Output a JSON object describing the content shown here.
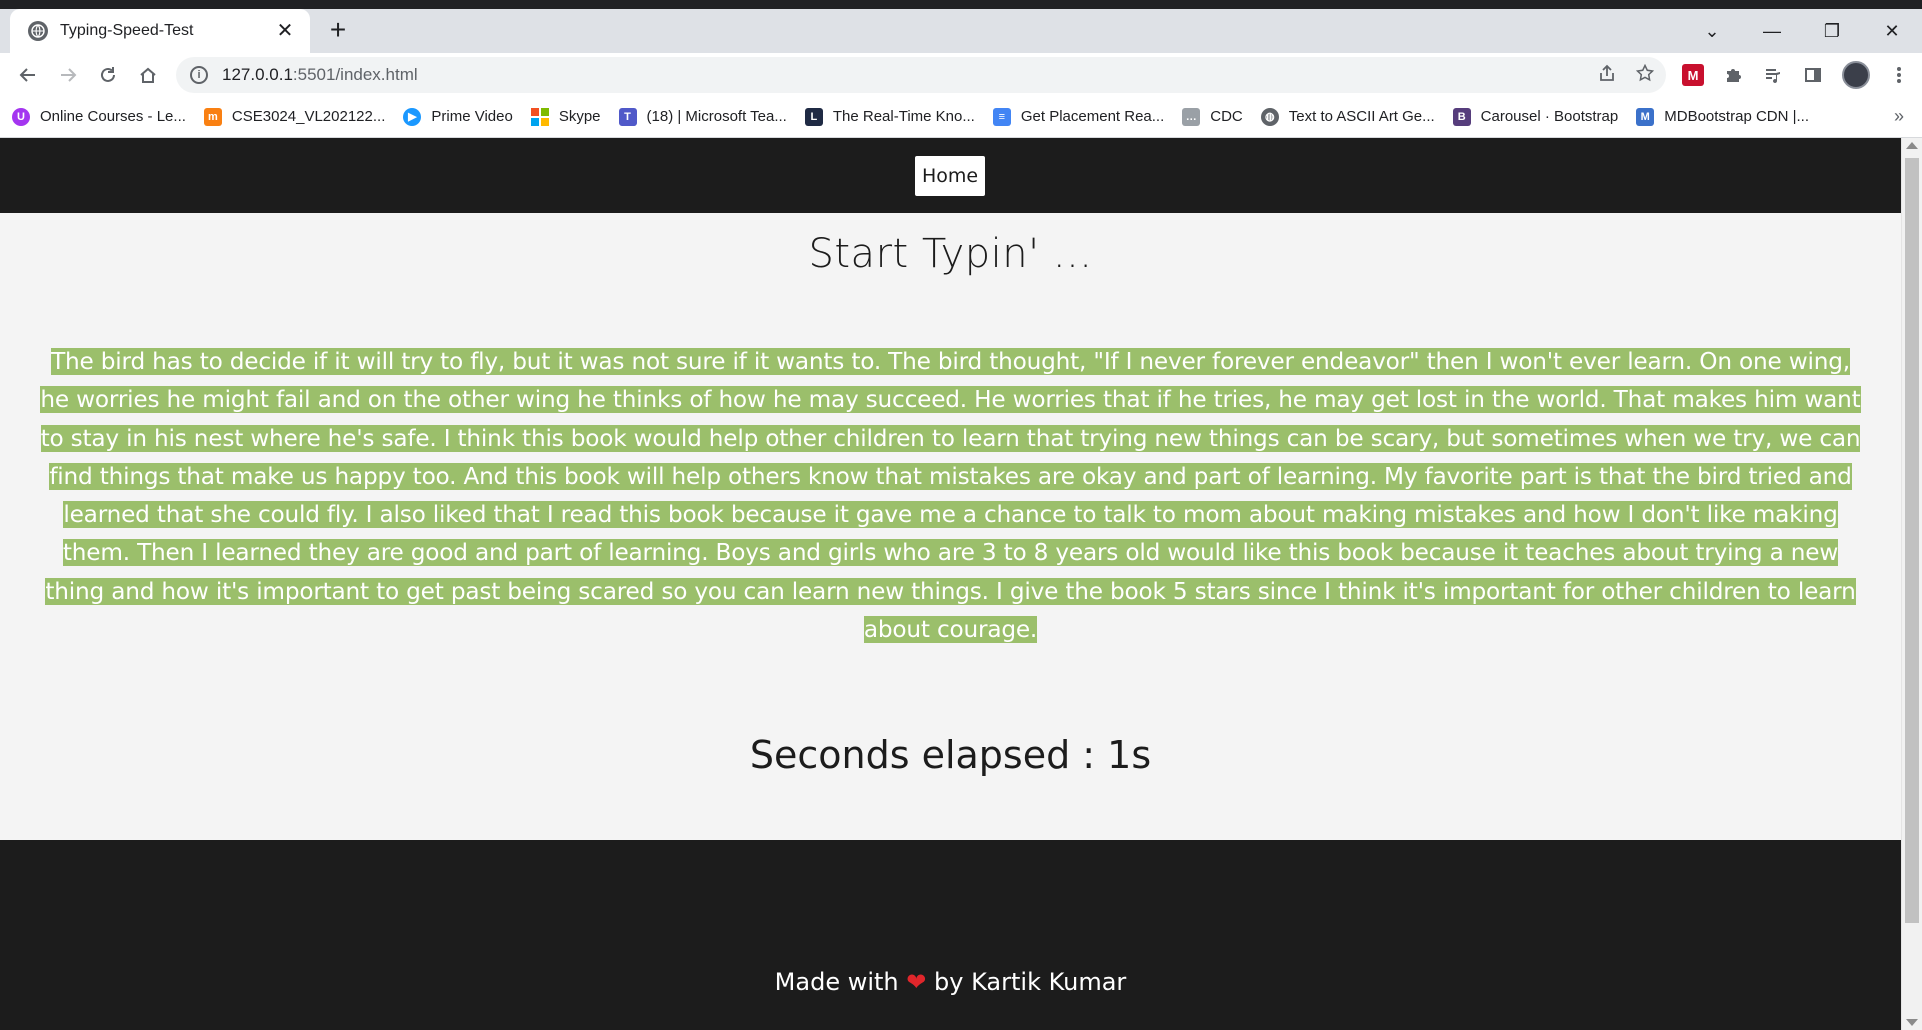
{
  "browser": {
    "tab_title": "Typing-Speed-Test",
    "tab_close": "✕",
    "new_tab": "+",
    "url_host": "127.0.0.1",
    "url_rest": ":5501/index.html",
    "window_controls": [
      "⌄",
      "—",
      "❐",
      "✕"
    ]
  },
  "bookmarks": [
    {
      "label": "Online Courses - Le...",
      "icon": "udemy-icon",
      "color": "#a435f0",
      "glyph": "U"
    },
    {
      "label": "CSE3024_VL202122...",
      "icon": "moodle-icon",
      "color": "#f98012",
      "glyph": "m"
    },
    {
      "label": "Prime Video",
      "icon": "prime-video-icon",
      "color": "#1a98ff",
      "glyph": "▶"
    },
    {
      "label": "Skype",
      "icon": "microsoft-icon",
      "color": "#f25022",
      "glyph": ""
    },
    {
      "label": "(18) | Microsoft Tea...",
      "icon": "teams-icon",
      "color": "#5059c9",
      "glyph": "T"
    },
    {
      "label": "The Real-Time Kno...",
      "icon": "lens-icon",
      "color": "#1f2a44",
      "glyph": "L"
    },
    {
      "label": "Get Placement Rea...",
      "icon": "docs-icon",
      "color": "#4285f4",
      "glyph": "≡"
    },
    {
      "label": "CDC",
      "icon": "cdc-icon",
      "color": "#9aa0a6",
      "glyph": "…"
    },
    {
      "label": "Text to ASCII Art Ge...",
      "icon": "globe-icon",
      "color": "#5f6368",
      "glyph": "◍"
    },
    {
      "label": "Carousel · Bootstrap",
      "icon": "bootstrap-icon",
      "color": "#563d7c",
      "glyph": "B"
    },
    {
      "label": "MDBootstrap CDN |...",
      "icon": "mdb-icon",
      "color": "#3b71ca",
      "glyph": "M"
    }
  ],
  "bookmarks_more": "»",
  "site": {
    "nav_home": "Home",
    "heading": "Start Typin' ...",
    "passage": "The bird has to decide if it will try to fly, but it was not sure if it wants to. The bird thought, \"If I never forever endeavor\" then I won't ever learn. On one wing, he worries he might fail and on the other wing he thinks of how he may succeed. He worries that if he tries, he may get lost in the world. That makes him want to stay in his nest where he's safe. I think this book would help other children to learn that trying new things can be scary, but sometimes when we try, we can find things that make us happy too. And this book will help others know that mistakes are okay and part of learning. My favorite part is that the bird tried and learned that she could fly. I also liked that I read this book because it gave me a chance to talk to mom about making mistakes and how I don't like making them. Then I learned they are good and part of learning. Boys and girls who are 3 to 8 years old would like this book because it teaches about trying a new thing and how it's important to get past being scared so you can learn new things. I give the book 5 stars since I think it's important for other children to learn about courage.",
    "timer": "Seconds elapsed : 1s",
    "footer_before": "Made with",
    "footer_heart": "❤",
    "footer_after": "by Kartik Kumar"
  },
  "colors": {
    "nav_bg": "#1c1c1c",
    "page_bg": "#f4f4f4",
    "highlight": "#9bbf6b",
    "heart": "#e0262b"
  }
}
